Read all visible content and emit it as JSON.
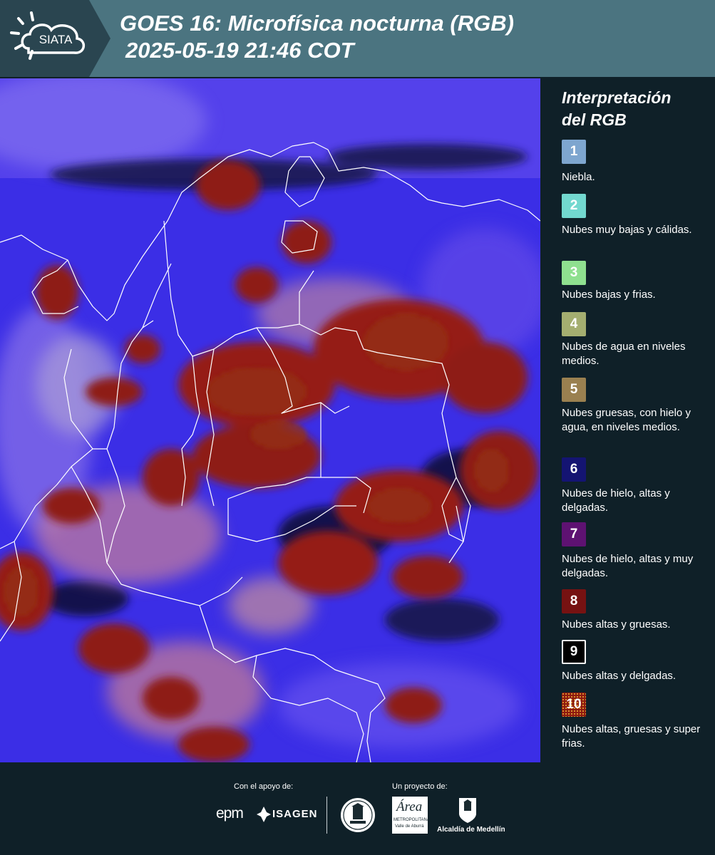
{
  "header": {
    "logo_text": "SIATA",
    "title_line1": "GOES 16: Microfísica nocturna (RGB)",
    "title_line2": "2025-05-19 21:46 COT"
  },
  "legend": {
    "title_line1": "Interpretación",
    "title_line2": "del RGB",
    "items": [
      {
        "number": "1",
        "color": "#7ea6cf",
        "label": "Niebla."
      },
      {
        "number": "2",
        "color": "#72d8cf",
        "label": "Nubes muy bajas y cálidas."
      },
      {
        "number": "3",
        "color": "#8fe08f",
        "label": "Nubes bajas y frias."
      },
      {
        "number": "4",
        "color": "#a4ae70",
        "label": "Nubes de agua en niveles medios."
      },
      {
        "number": "5",
        "color": "#9a8050",
        "label": "Nubes gruesas, con hielo y agua, en niveles medios."
      },
      {
        "number": "6",
        "color": "#141472",
        "label": "Nubes de hielo, altas y delgadas."
      },
      {
        "number": "7",
        "color": "#5e1272",
        "label": "Nubes de hielo, altas y muy delgadas."
      },
      {
        "number": "8",
        "color": "#761212",
        "label": "Nubes altas y gruesas."
      },
      {
        "number": "9",
        "color": "#000000",
        "label": "Nubes altas y delgadas."
      },
      {
        "number": "10",
        "color": "#8e1a10",
        "label": "Nubes altas, gruesas y super frias."
      }
    ]
  },
  "footer": {
    "support_label": "Con el apoyo de:",
    "project_label": "Un proyecto de:",
    "sponsor_epm": "epm",
    "sponsor_isagen": "ISAGEN",
    "area_logo_text": "Área",
    "area_logo_sub1": "METROPOLITANA",
    "area_logo_sub2": "Valle de Aburrá",
    "alcaldia_text": "Alcaldía de Medellín"
  }
}
